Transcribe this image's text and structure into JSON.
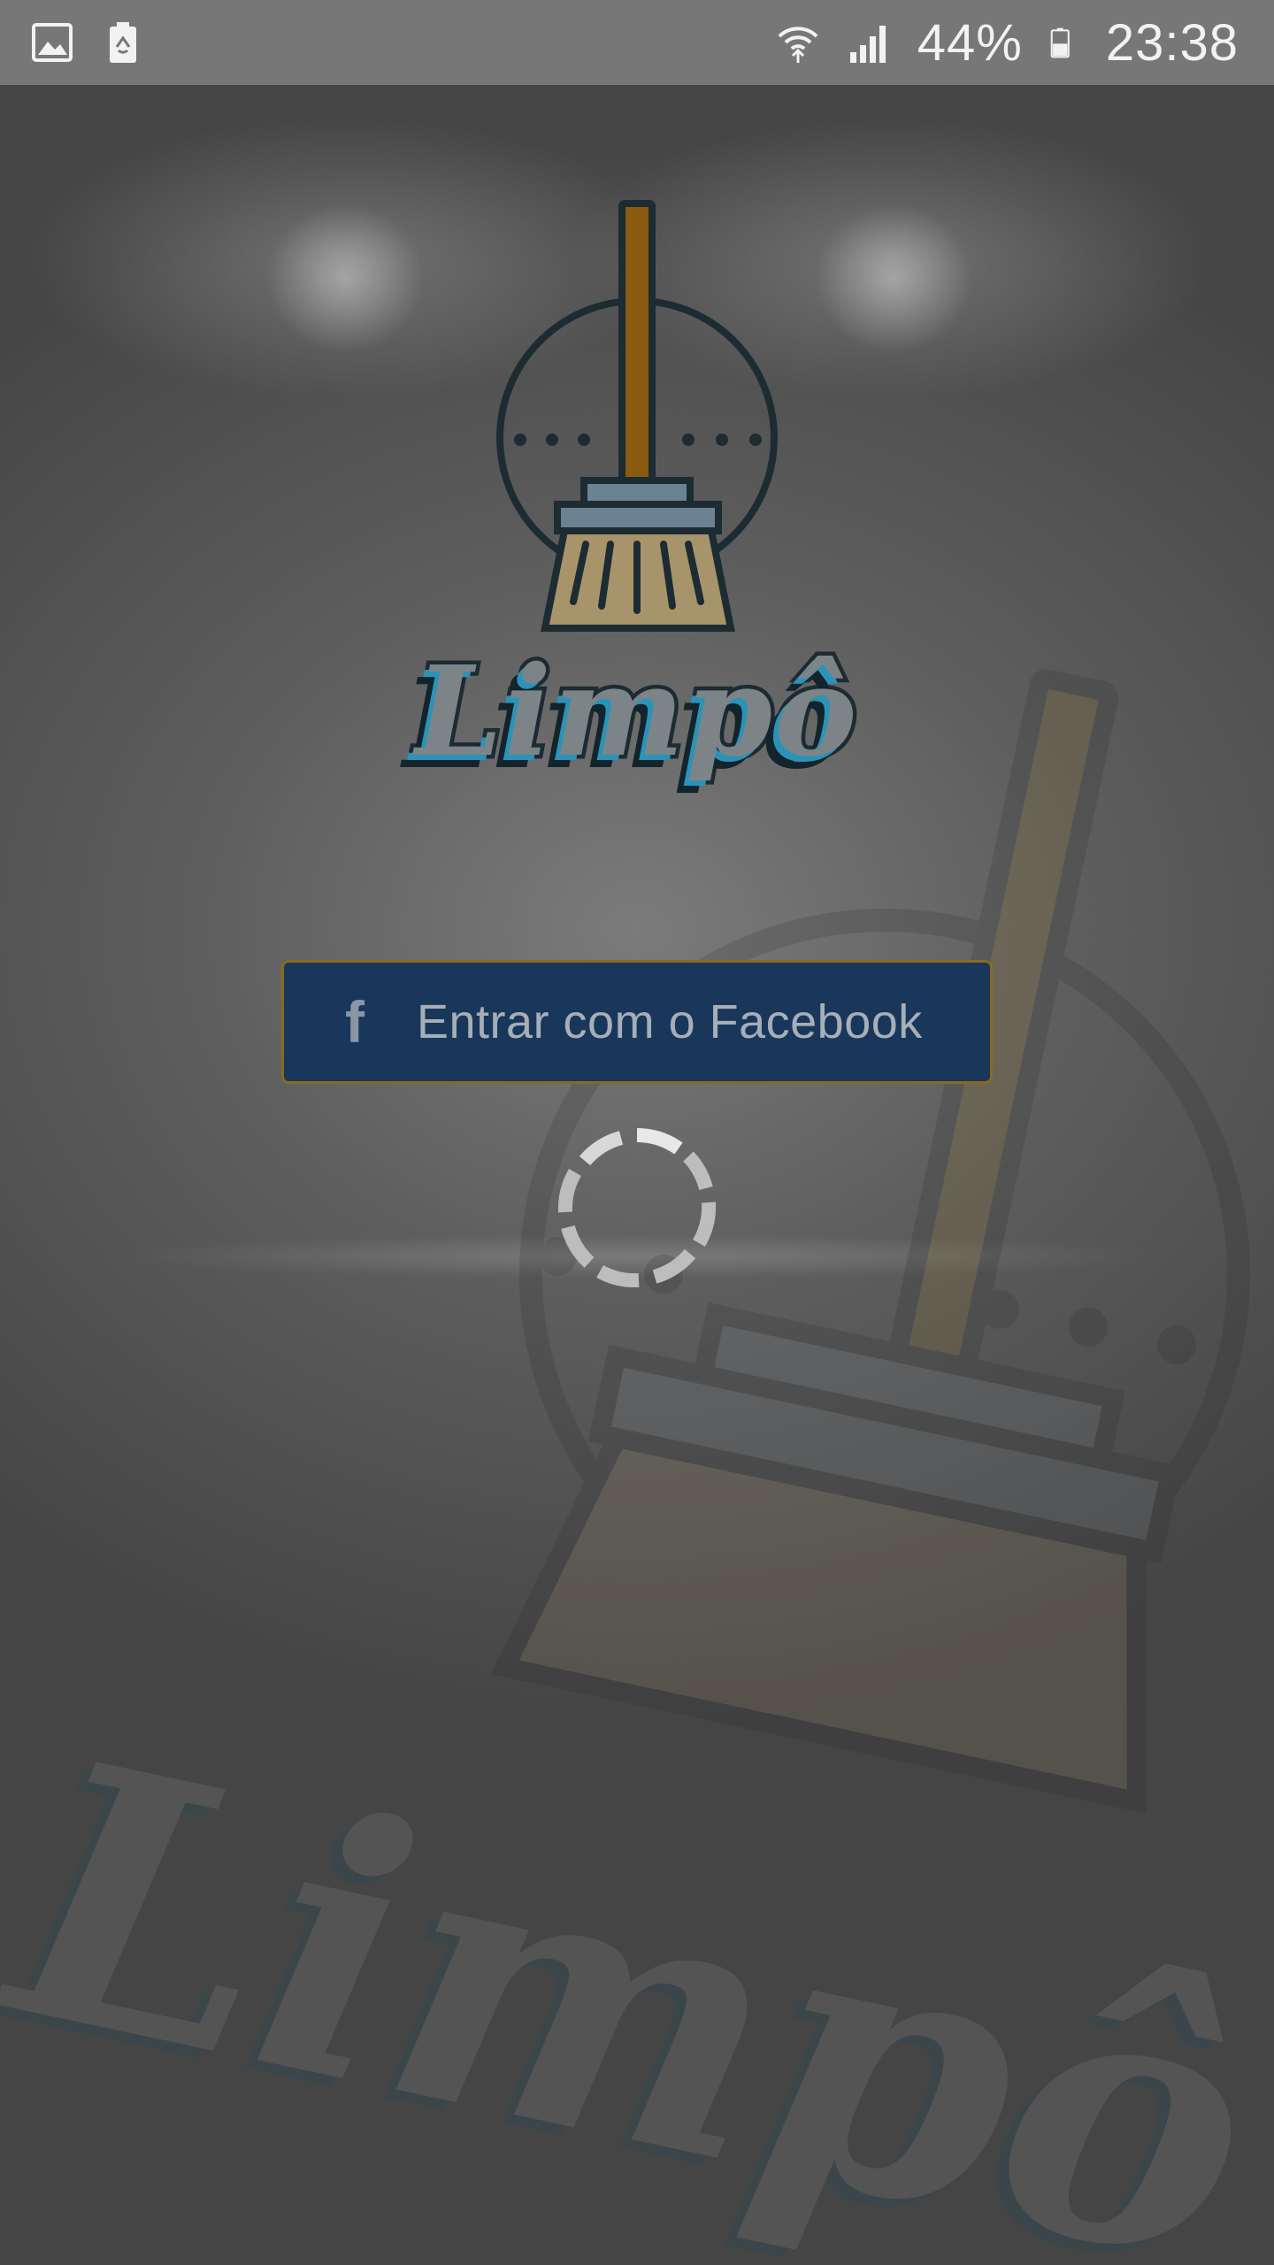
{
  "status_bar": {
    "left_icons": [
      "image-icon",
      "battery-saver-icon"
    ],
    "battery": "44%",
    "time": "23:38",
    "right_icons": [
      "wifi-icon",
      "signal-icon",
      "battery-icon"
    ]
  },
  "app": {
    "name": "Limpô",
    "watermark_text": "Limpô"
  },
  "login": {
    "facebook_icon": "f",
    "facebook_label": "Entrar com o Facebook"
  },
  "colors": {
    "facebook_button": "#19375a",
    "facebook_border": "#8a6a1e",
    "logo_accent": "#2a93b8",
    "broom_handle": "#8a5a10"
  },
  "loading": {
    "spinner_icon": "loading-spinner-icon"
  }
}
